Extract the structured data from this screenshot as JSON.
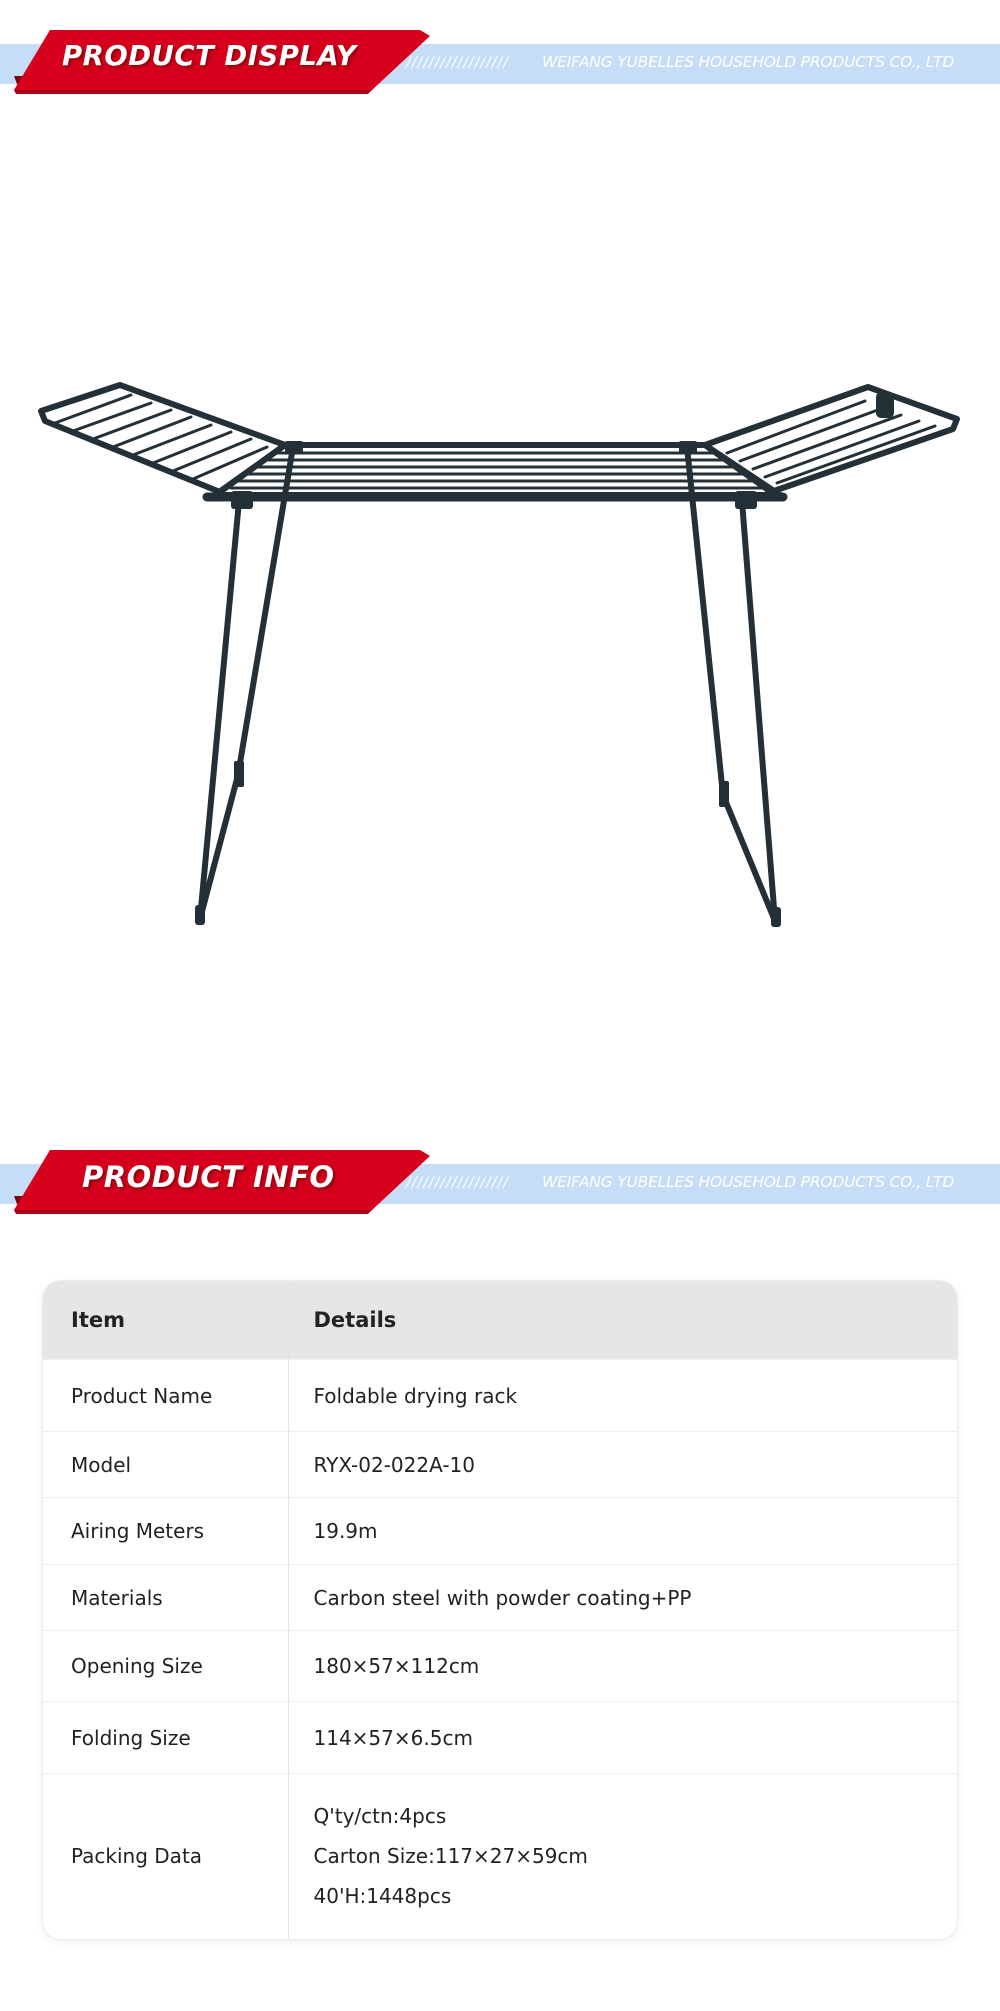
{
  "banners": {
    "display": {
      "title": "PRODUCT DISPLAY",
      "slashes": "//////////////////",
      "company": "WEIFANG YUBELLES HOUSEHOLD PRODUCTS CO., LTD"
    },
    "info": {
      "title": "PRODUCT INFO",
      "slashes": "//////////////////",
      "company": "WEIFANG YUBELLES HOUSEHOLD PRODUCTS CO., LTD"
    }
  },
  "colors": {
    "banner_red": "#d6001c",
    "banner_strip": "#c5ddf6",
    "rack_metal": "#243038",
    "table_header": "#e6e6e8"
  },
  "product_image": {
    "subject": "foldable drying rack"
  },
  "table": {
    "headers": [
      "Item",
      "Details"
    ],
    "rows": [
      {
        "item": "Product Name",
        "details": [
          "Foldable drying rack"
        ]
      },
      {
        "item": "Model",
        "details": [
          "RYX-02-022A-10"
        ]
      },
      {
        "item": "Airing Meters",
        "details": [
          "19.9m"
        ]
      },
      {
        "item": "Materials",
        "details": [
          "Carbon steel with powder coating+PP"
        ]
      },
      {
        "item": "Opening Size",
        "details": [
          "180×57×112cm"
        ]
      },
      {
        "item": "Folding Size",
        "details": [
          "114×57×6.5cm"
        ]
      },
      {
        "item": "Packing Data",
        "details": [
          "Q'ty/ctn:4pcs",
          "Carton Size:117×27×59cm",
          "40'H:1448pcs"
        ]
      }
    ]
  }
}
